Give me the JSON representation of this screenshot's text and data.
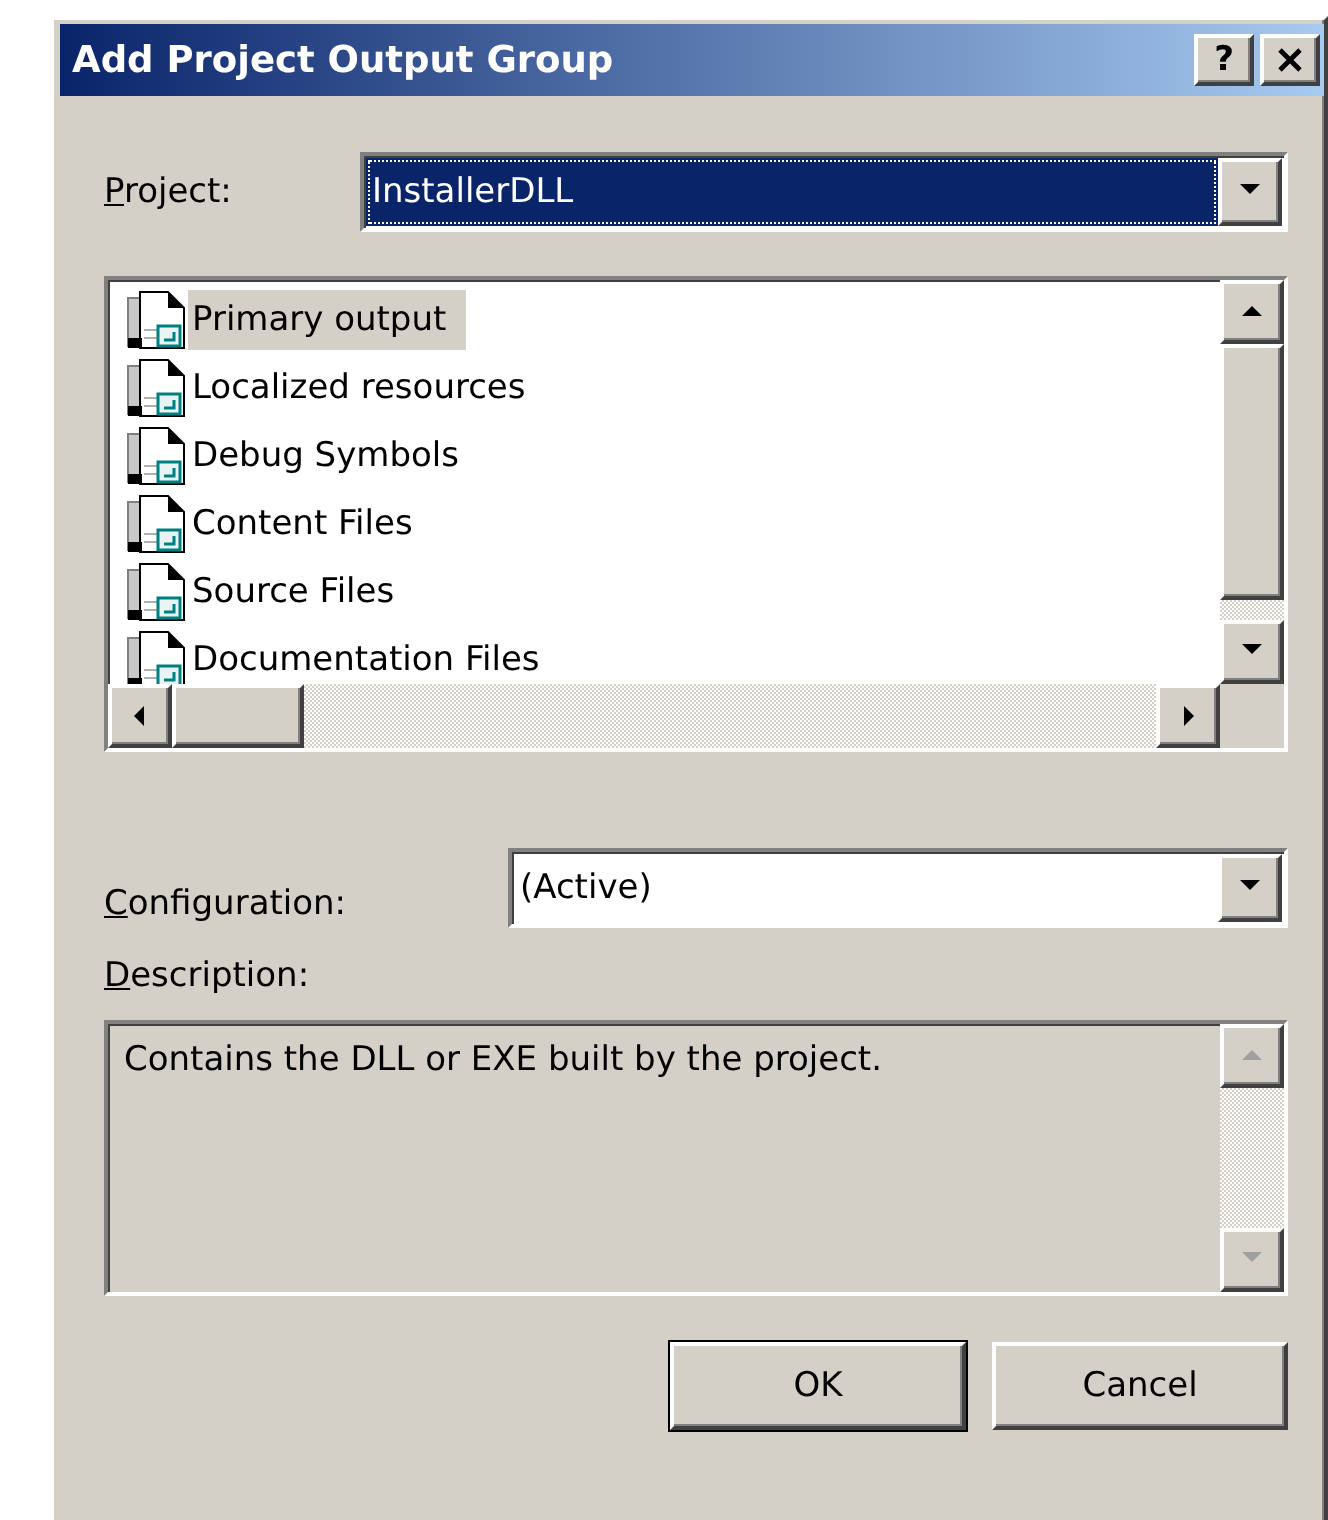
{
  "window": {
    "title": "Add Project Output Group",
    "help_button": "?"
  },
  "project": {
    "label": "Project:",
    "underline_first": true,
    "value": "InstallerDLL",
    "focused": true
  },
  "outputs": [
    {
      "label": "Primary output",
      "selected": true
    },
    {
      "label": "Localized resources",
      "selected": false
    },
    {
      "label": "Debug Symbols",
      "selected": false
    },
    {
      "label": "Content Files",
      "selected": false
    },
    {
      "label": "Source Files",
      "selected": false
    },
    {
      "label": "Documentation Files",
      "selected": false
    }
  ],
  "configuration": {
    "label": "Configuration:",
    "underline_first": true,
    "value": "(Active)",
    "focused": false
  },
  "description": {
    "label": "Description:",
    "underline_first": true,
    "text": "Contains the DLL or EXE built by the project."
  },
  "buttons": [
    {
      "label": "OK",
      "default": true
    },
    {
      "label": "Cancel",
      "default": false
    }
  ]
}
